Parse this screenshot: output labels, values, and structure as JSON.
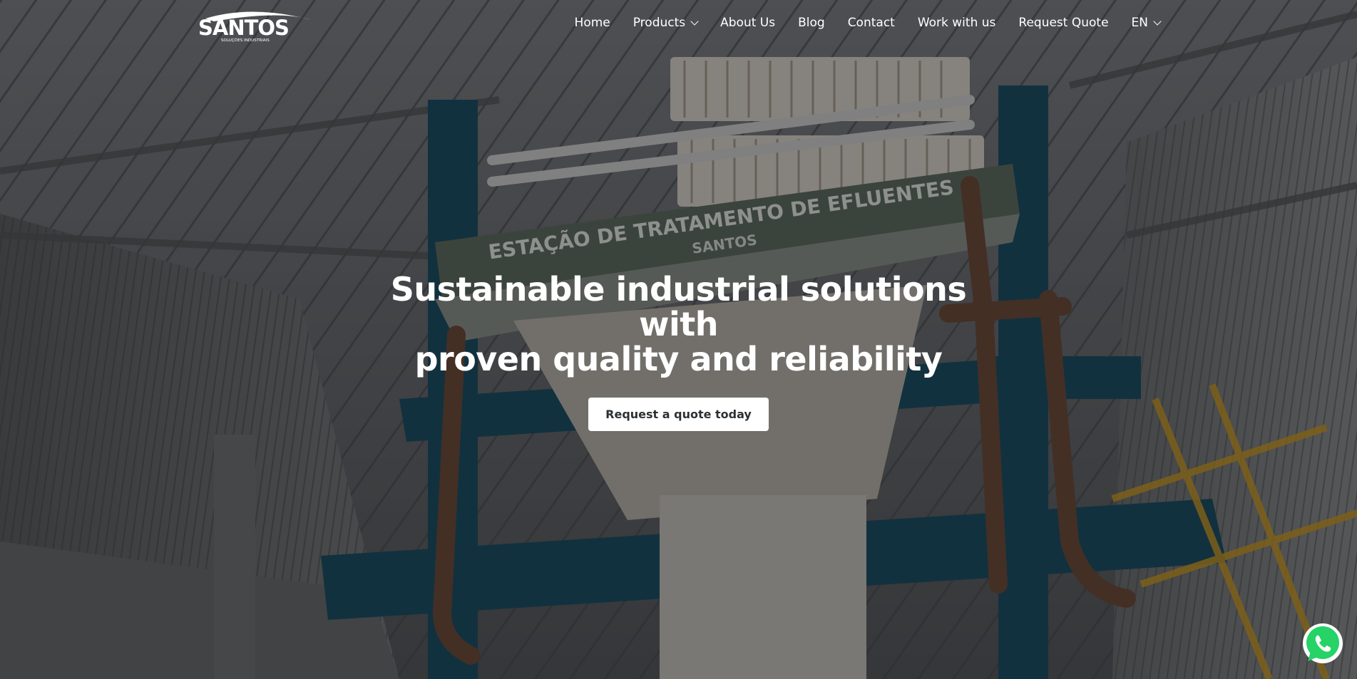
{
  "brand": {
    "logo_text": "SANTOS",
    "logo_subtext": "SOLUÇÕES INDUSTRIAIS"
  },
  "nav": {
    "items": [
      {
        "label": "Home",
        "has_dropdown": false
      },
      {
        "label": "Products",
        "has_dropdown": true
      },
      {
        "label": "About Us",
        "has_dropdown": false
      },
      {
        "label": "Blog",
        "has_dropdown": false
      },
      {
        "label": "Contact",
        "has_dropdown": false
      },
      {
        "label": "Work with us",
        "has_dropdown": false
      },
      {
        "label": "Request Quote",
        "has_dropdown": false
      },
      {
        "label": "EN",
        "has_dropdown": true
      }
    ]
  },
  "hero": {
    "headline_line1": "Sustainable industrial solutions with",
    "headline_line2": "proven quality and reliability",
    "cta_label": "Request a quote today",
    "background_sign_text": "ESTAÇÃO DE TRATAMENTO DE EFLUENTES",
    "background_sign_logo": "SANTOS"
  },
  "whatsapp": {
    "icon": "whatsapp-icon",
    "color": "#25d366"
  },
  "colors": {
    "sign_green": "#5f6e62",
    "frame_blue": "#1e4f66",
    "pipe_brown": "#6e4c3d",
    "rail_yellow": "#c99a2a",
    "cta_bg": "#ffffff",
    "cta_text": "#2d3033"
  }
}
